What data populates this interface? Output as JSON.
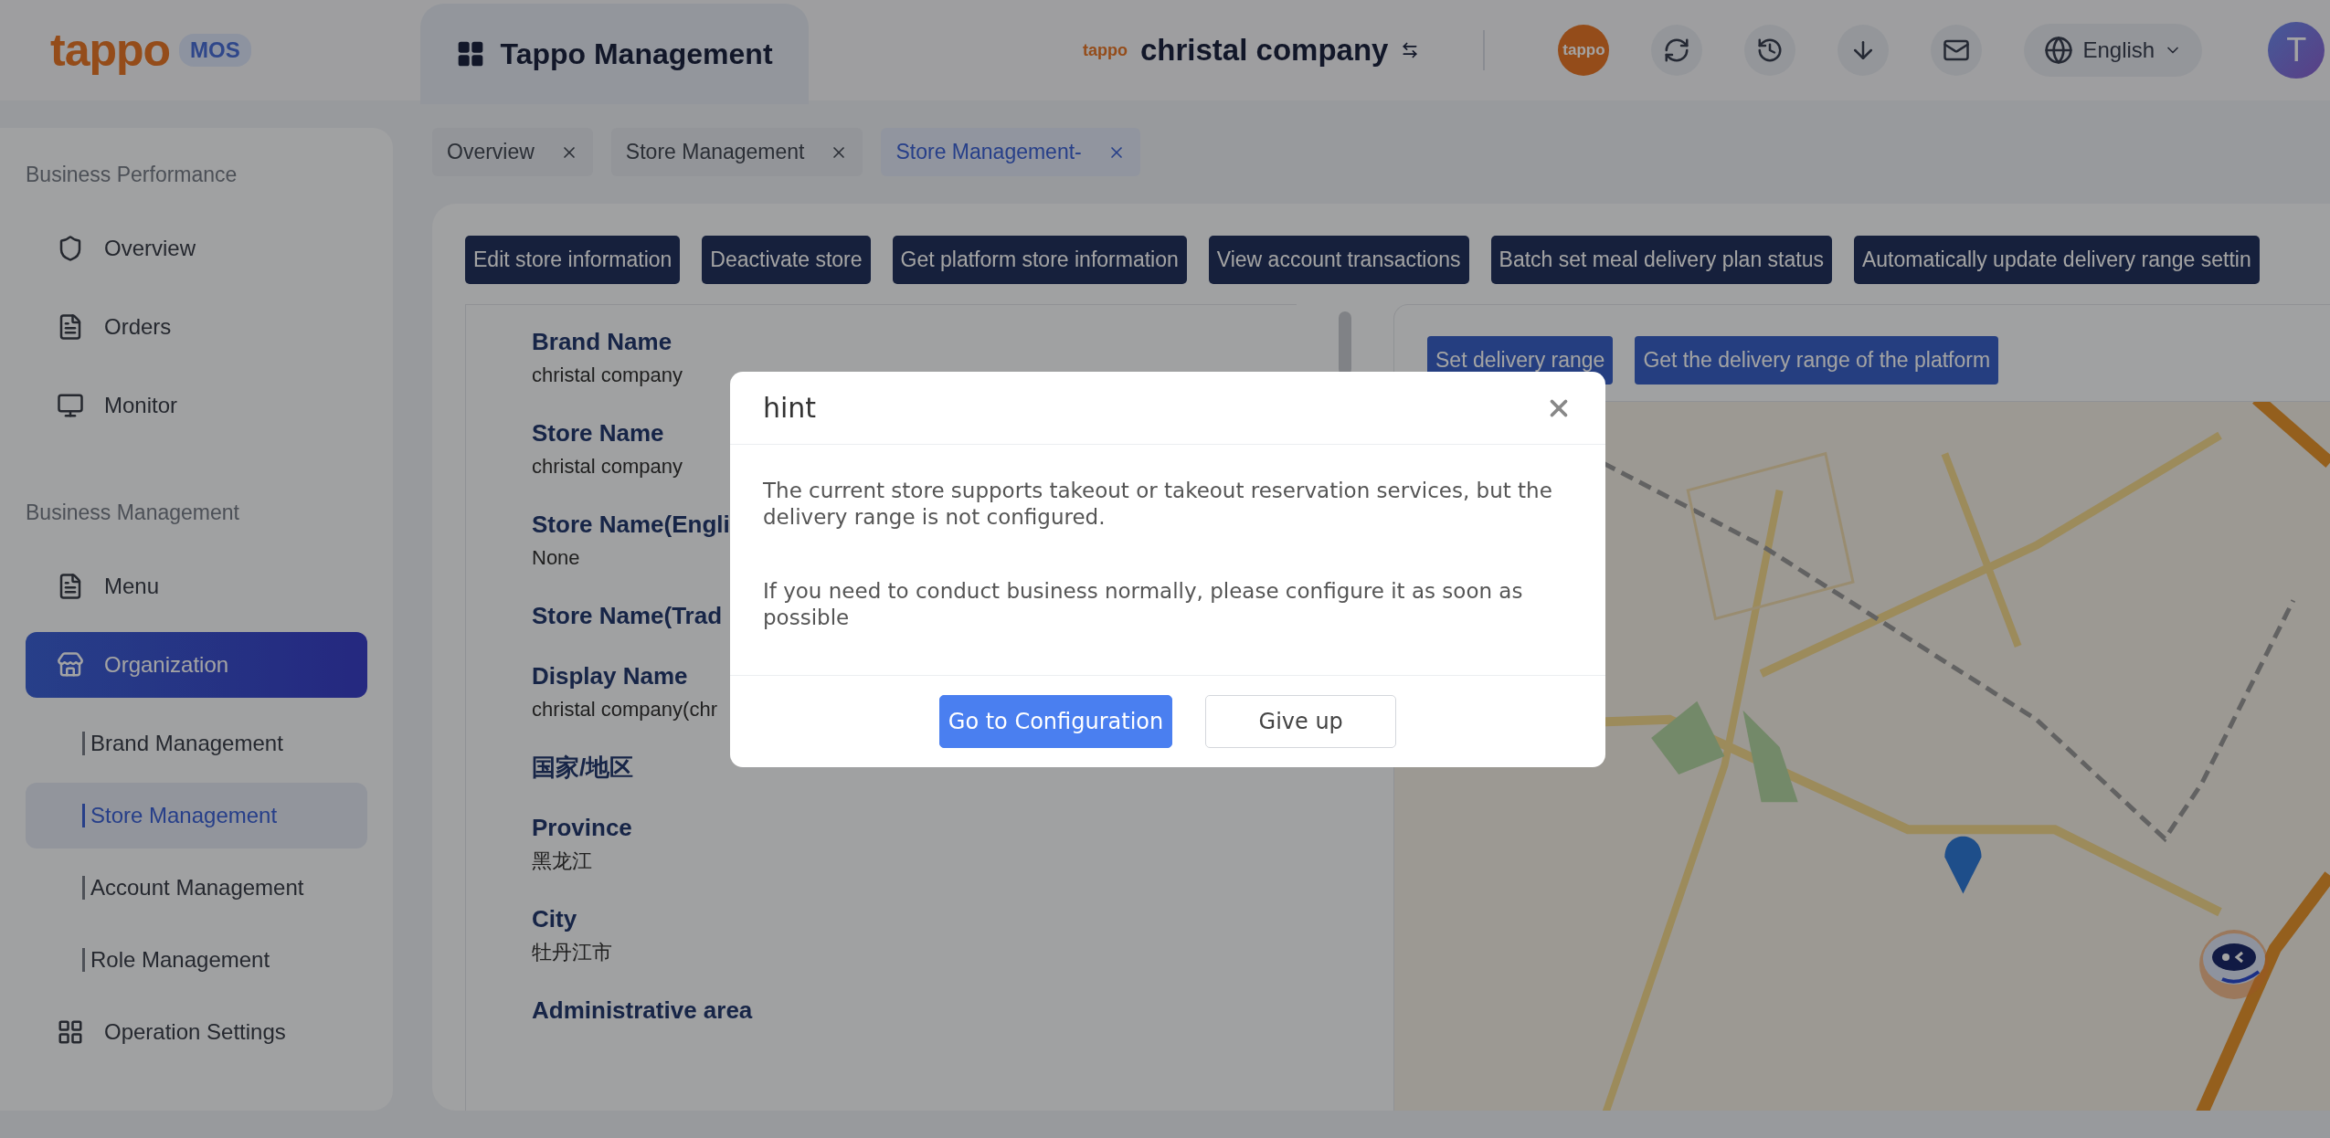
{
  "header": {
    "logo": "tappo",
    "logo_badge": "MOS",
    "app_tab": "Tappo Management",
    "company_logo": "tappo",
    "company": "christal company",
    "toolbar_logo": "tappo",
    "language": "English",
    "avatar": "T"
  },
  "tabs": [
    {
      "label": "Overview",
      "selected": false
    },
    {
      "label": "Store Management",
      "selected": false
    },
    {
      "label": "Store Management-",
      "selected": true
    }
  ],
  "sidebar": {
    "sections": [
      {
        "title": "Business Performance",
        "items": [
          {
            "label": "Overview",
            "selected": false
          },
          {
            "label": "Orders",
            "selected": false
          },
          {
            "label": "Monitor",
            "selected": false
          }
        ]
      },
      {
        "title": "Business Management",
        "items": [
          {
            "label": "Menu",
            "selected": false
          },
          {
            "label": "Organization",
            "selected": true,
            "children": [
              {
                "label": "Brand Management",
                "selected": false
              },
              {
                "label": "Store Management",
                "selected": true
              },
              {
                "label": "Account Management",
                "selected": false
              },
              {
                "label": "Role Management",
                "selected": false
              }
            ]
          },
          {
            "label": "Operation Settings",
            "selected": false
          }
        ]
      }
    ]
  },
  "actions": [
    "Edit store information",
    "Deactivate store",
    "Get platform store information",
    "View account transactions",
    "Batch set meal delivery plan status",
    "Automatically update delivery range settin"
  ],
  "fields": [
    {
      "label": "Brand Name",
      "value": "christal company"
    },
    {
      "label": "Store Name",
      "value": "christal company"
    },
    {
      "label": "Store Name(Engli",
      "value": "None"
    },
    {
      "label": "Store Name(Trad"
    },
    {
      "label": "Display Name",
      "value": "christal company(chr"
    },
    {
      "label": "国家/地区"
    },
    {
      "label": "Province",
      "value": "黑龙江"
    },
    {
      "label": "City",
      "value": "牡丹江市"
    },
    {
      "label": "Administrative area"
    }
  ],
  "map": {
    "buttons": [
      "Set delivery range",
      "Get the delivery range of the platform"
    ],
    "kind": "picture"
  },
  "dialog": {
    "title": "hint",
    "paragraphs": [
      "The current store supports takeout or takeout reservation services, but the delivery range is not configured.",
      "If you need to conduct business normally, please configure it as soon as possible"
    ],
    "buttons": [
      {
        "label": "Go to Configuration",
        "kind": "primary"
      },
      {
        "label": "Give up",
        "kind": "default"
      }
    ]
  }
}
